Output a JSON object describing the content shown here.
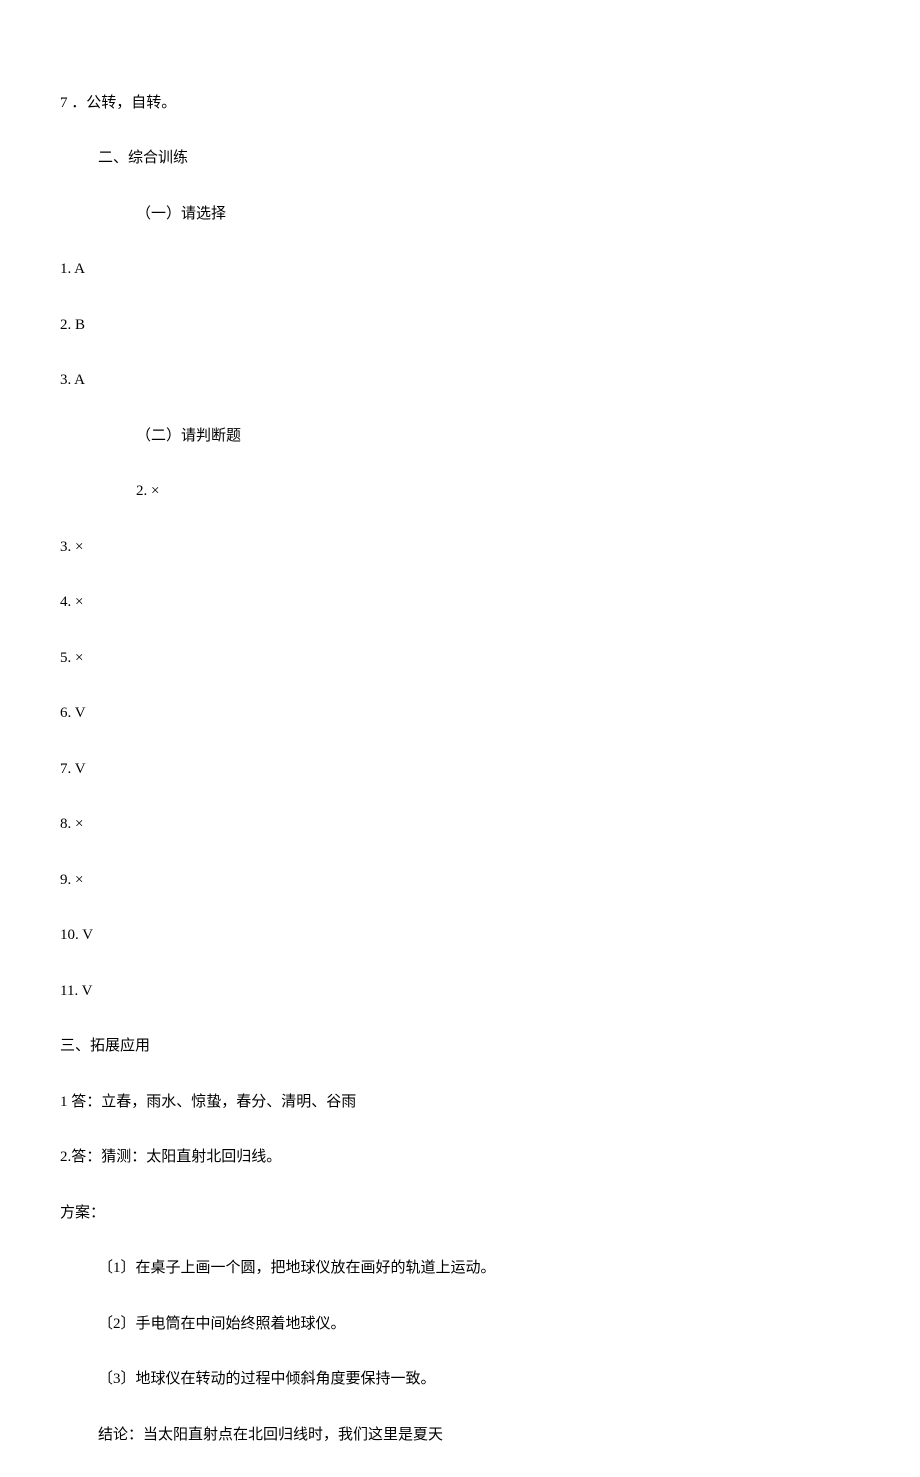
{
  "lines": {
    "l1": "7 ．公转，自转。",
    "l2": "二、综合训练",
    "l3": "（一）请选择",
    "l4": "1. A",
    "l5": "2. B",
    "l6": "3. A",
    "l7": "（二）请判断题",
    "l8": "2. ×",
    "l9": "3. ×",
    "l10": "4. ×",
    "l11": "5. ×",
    "l12": "6. V",
    "l13": "7. V",
    "l14": "8. ×",
    "l15": "9. ×",
    "l16": "10. V",
    "l17": "11. V",
    "l18": "三、拓展应用",
    "l19": "1 答：立春，雨水、惊蛰，春分、清明、谷雨",
    "l20": "2.答：猜测：太阳直射北回归线。",
    "l21": "方案：",
    "l22": "〔1〕在桌子上画一个圆，把地球仪放在画好的轨道上运动。",
    "l23": "〔2〕手电筒在中间始终照着地球仪。",
    "l24": "〔3〕地球仪在转动的过程中倾斜角度要保持一致。",
    "l25": "结论：当太阳直射点在北回归线时，我们这里是夏天"
  }
}
